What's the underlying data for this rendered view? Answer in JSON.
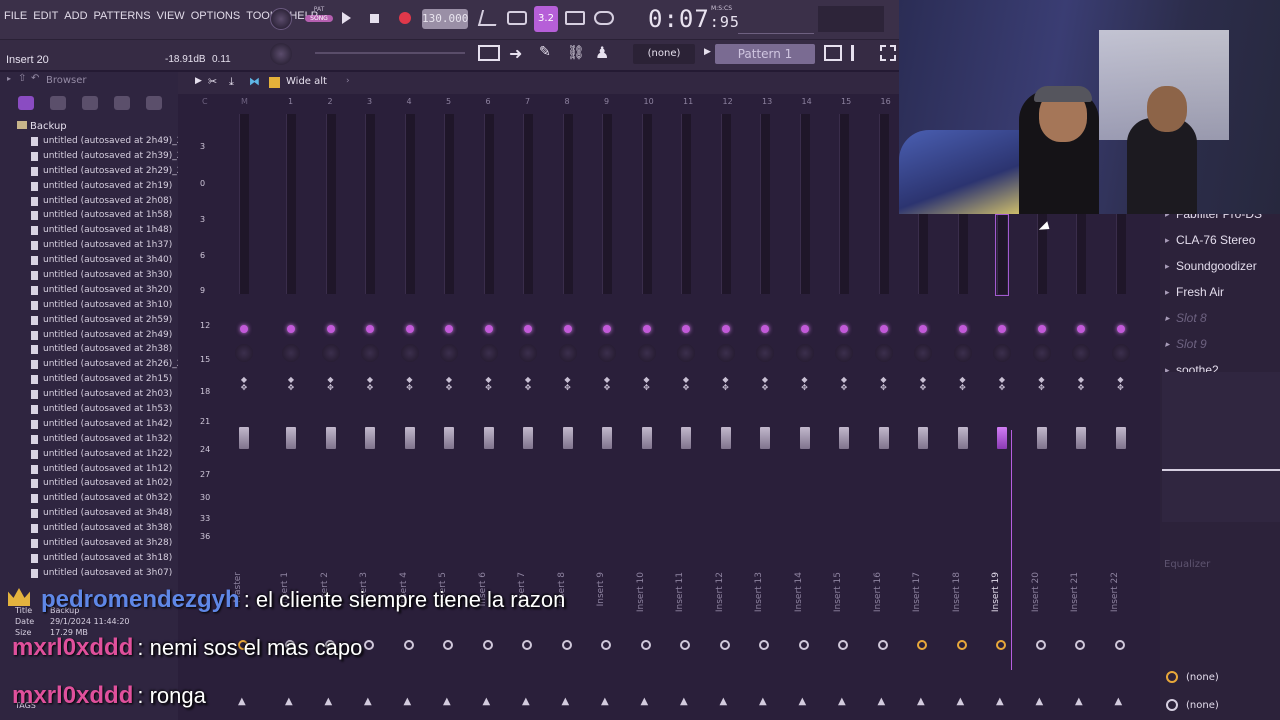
{
  "menu": [
    "FILE",
    "EDIT",
    "ADD",
    "PATTERNS",
    "VIEW",
    "OPTIONS",
    "TOOLS",
    "HELP"
  ],
  "transport": {
    "pat_label": "PAT",
    "song_label": "SONG",
    "tempo": "130.000",
    "time_main": "0:07",
    "time_sub": ":95",
    "time_unit": "M:S:CS",
    "step_label": "3.2"
  },
  "insert": {
    "name": "Insert 20",
    "volume": "-18.91dB",
    "pan": "0.11"
  },
  "toolbar": {
    "channel_select": "(none)",
    "pattern": "Pattern 1",
    "plus": "+"
  },
  "browser": {
    "title": "Browser",
    "folder": "Backup",
    "files": [
      "untitled (autosaved at 2h49)_2",
      "untitled (autosaved at 2h39)_2",
      "untitled (autosaved at 2h29)_2",
      "untitled (autosaved at 2h19)",
      "untitled (autosaved at 2h08)",
      "untitled (autosaved at 1h58)",
      "untitled (autosaved at 1h48)",
      "untitled (autosaved at 1h37)",
      "untitled (autosaved at 3h40)",
      "untitled (autosaved at 3h30)",
      "untitled (autosaved at 3h20)",
      "untitled (autosaved at 3h10)",
      "untitled (autosaved at 2h59)",
      "untitled (autosaved at 2h49)",
      "untitled (autosaved at 2h38)",
      "untitled (autosaved at 2h26)_2",
      "untitled (autosaved at 2h15)",
      "untitled (autosaved at 2h03)",
      "untitled (autosaved at 1h53)",
      "untitled (autosaved at 1h42)",
      "untitled (autosaved at 1h32)",
      "untitled (autosaved at 1h22)",
      "untitled (autosaved at 1h12)",
      "untitled (autosaved at 1h02)",
      "untitled (autosaved at 0h32)",
      "untitled (autosaved at 3h48)",
      "untitled (autosaved at 3h38)",
      "untitled (autosaved at 3h28)",
      "untitled (autosaved at 3h18)",
      "untitled (autosaved at 3h07)"
    ],
    "file_info": {
      "title_label": "Title",
      "title_value": "Backup",
      "date_label": "Date",
      "date_value": "29/1/2024 11:44:20",
      "size_label": "Size",
      "size_value": "17.29 MB",
      "tags_label": "TAGS"
    }
  },
  "mixer": {
    "preset": "Wide alt",
    "head_letters": [
      "C",
      "M"
    ],
    "numbers": [
      "1",
      "2",
      "3",
      "4",
      "5",
      "6",
      "7",
      "8",
      "9",
      "10",
      "11",
      "12",
      "13",
      "14",
      "15",
      "16"
    ],
    "scale": [
      "3",
      "0",
      "3",
      "6",
      "9",
      "12",
      "15",
      "18",
      "21",
      "24",
      "27",
      "30",
      "33",
      "36"
    ],
    "strips": [
      "Master",
      "Insert 1",
      "Insert 2",
      "Insert 3",
      "Insert 4",
      "Insert 5",
      "Insert 6",
      "Insert 7",
      "Insert 8",
      "Insert 9",
      "Insert 10",
      "Insert 11",
      "Insert 12",
      "Insert 13",
      "Insert 14",
      "Insert 15",
      "Insert 16",
      "Insert 17",
      "Insert 18",
      "Insert 19",
      "Insert 20",
      "Insert 21",
      "Insert 22"
    ],
    "selected_index": 19
  },
  "fx": {
    "slots": [
      "Fabfilter Pro-DS",
      "CLA-76 Stereo",
      "Soundgoodizer",
      "Fresh Air",
      "Slot 8",
      "Slot 9",
      "soothe2"
    ],
    "eq_label": "Equalizer",
    "bottom_1": "(none)",
    "bottom_2": "(none)"
  },
  "chat": [
    {
      "user": "pedromendezgyh",
      "message": ": el cliente siempre tiene la razon"
    },
    {
      "user": "mxrl0xddd",
      "message": ": nemi sos el mas capo"
    },
    {
      "user": "mxrl0xddd",
      "message": ": ronga"
    }
  ]
}
